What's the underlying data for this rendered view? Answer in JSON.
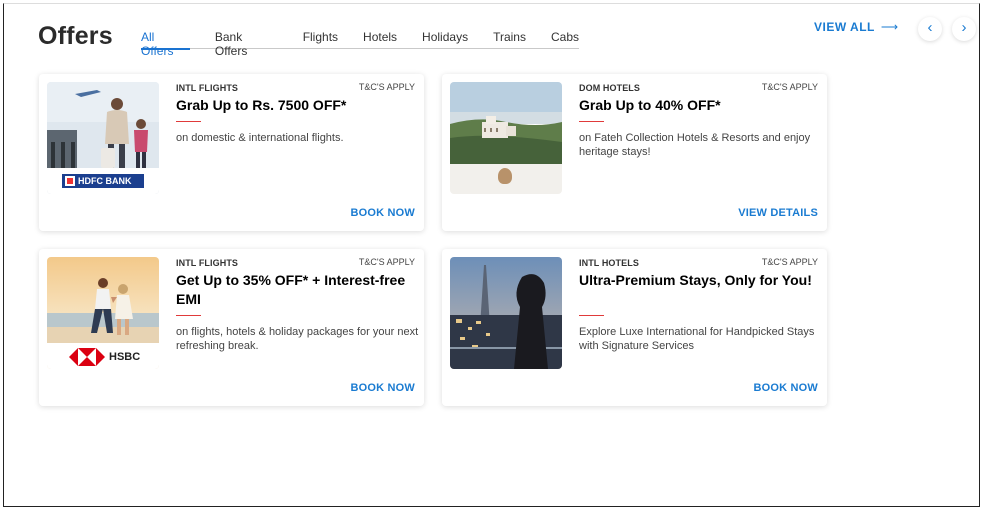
{
  "header": {
    "title": "Offers",
    "tabs": [
      {
        "label": "All Offers",
        "active": true
      },
      {
        "label": "Bank Offers",
        "active": false
      },
      {
        "label": "Flights",
        "active": false
      },
      {
        "label": "Hotels",
        "active": false
      },
      {
        "label": "Holidays",
        "active": false
      },
      {
        "label": "Trains",
        "active": false
      },
      {
        "label": "Cabs",
        "active": false
      }
    ],
    "view_all": "VIEW ALL",
    "view_all_arrow": "⟶",
    "prev_icon": "‹",
    "next_icon": "›"
  },
  "offers": [
    {
      "category": "INTL FLIGHTS",
      "tnc": "T&C'S APPLY",
      "title": "Grab Up to Rs. 7500 OFF*",
      "description": "on domestic & international flights.",
      "cta": "BOOK NOW",
      "bank_logo": "HDFC BANK",
      "image": "airport-travellers"
    },
    {
      "category": "DOM HOTELS",
      "tnc": "T&C'S APPLY",
      "title": "Grab Up to 40% OFF*",
      "description": "on Fateh Collection Hotels & Resorts and enjoy heritage stays!",
      "cta": "VIEW DETAILS",
      "image": "hilltop-palace"
    },
    {
      "category": "INTL FLIGHTS",
      "tnc": "T&C'S APPLY",
      "title": "Get Up to 35% OFF* + Interest-free EMI",
      "description": "on flights, hotels & holiday packages for your next refreshing break.",
      "cta": "BOOK NOW",
      "bank_logo": "HSBC",
      "image": "beach-couple"
    },
    {
      "category": "INTL HOTELS",
      "tnc": "T&C'S APPLY",
      "title": "Ultra-Premium Stays, Only for You!",
      "description": "Explore Luxe International for Handpicked Stays with Signature Services",
      "cta": "BOOK NOW",
      "image": "city-skyline-woman"
    }
  ],
  "colors": {
    "accent": "#1a7bd1",
    "rule": "#e03a3a",
    "hdfc_blue": "#1b3f8f",
    "hsbc_red": "#db0011"
  }
}
